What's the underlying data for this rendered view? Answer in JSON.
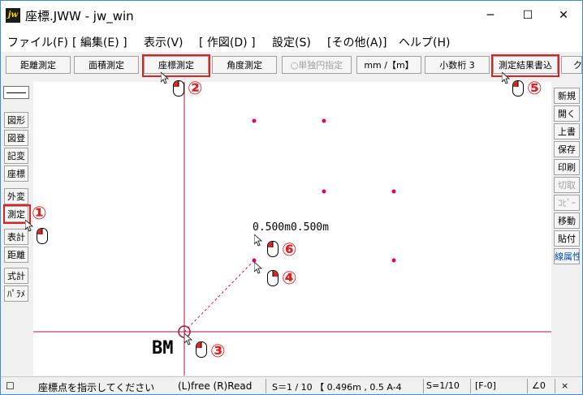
{
  "window": {
    "app_icon": "jw",
    "title": "座標.JWW - jw_win",
    "minimize": "─",
    "maximize": "☐",
    "close": "✕"
  },
  "menu": [
    "ファイル(F)",
    "[ 編集(E) ]",
    "表示(V)",
    "[ 作図(D) ]",
    "設定(S)",
    "[その他(A)]",
    "ヘルプ(H)"
  ],
  "toolbar": {
    "distance": "距離測定",
    "area": "面積測定",
    "coordinate": "座標測定",
    "angle": "角度測定",
    "single_arc": "○単独円指定",
    "unit": "mm /【m】",
    "decimal": "小数桁 3",
    "write_result": "測定結果書込",
    "overflow": "ク"
  },
  "left_tools": [
    "図形",
    "図登",
    "記変",
    "座標",
    "外変",
    "測定",
    "表計",
    "距離",
    "式計",
    "ﾊﾟﾗﾒ"
  ],
  "right_tools": [
    "新規",
    "開く",
    "上書",
    "保存",
    "印刷",
    "切取",
    "ｺﾋﾟｰ",
    "移動",
    "貼付",
    "線属性"
  ],
  "canvas": {
    "coord_text": "0.500m0.500m",
    "bm_label": "BM",
    "colors": {
      "axis": "#b0103a",
      "point": "#e0006e",
      "dashed": "#e0006e"
    }
  },
  "callouts": [
    "①",
    "②",
    "③",
    "④",
    "⑤",
    "⑥"
  ],
  "status": {
    "checkbox": "☐",
    "prompt": "座標点を指示してください",
    "mode": "(L)free (R)Read",
    "scale": "S＝1 / 10 【 0.496m , 0.5 A-4",
    "scale2": "S=1/10",
    "layer": "[F-0]",
    "angle": "∠0",
    "zoom": "×"
  }
}
